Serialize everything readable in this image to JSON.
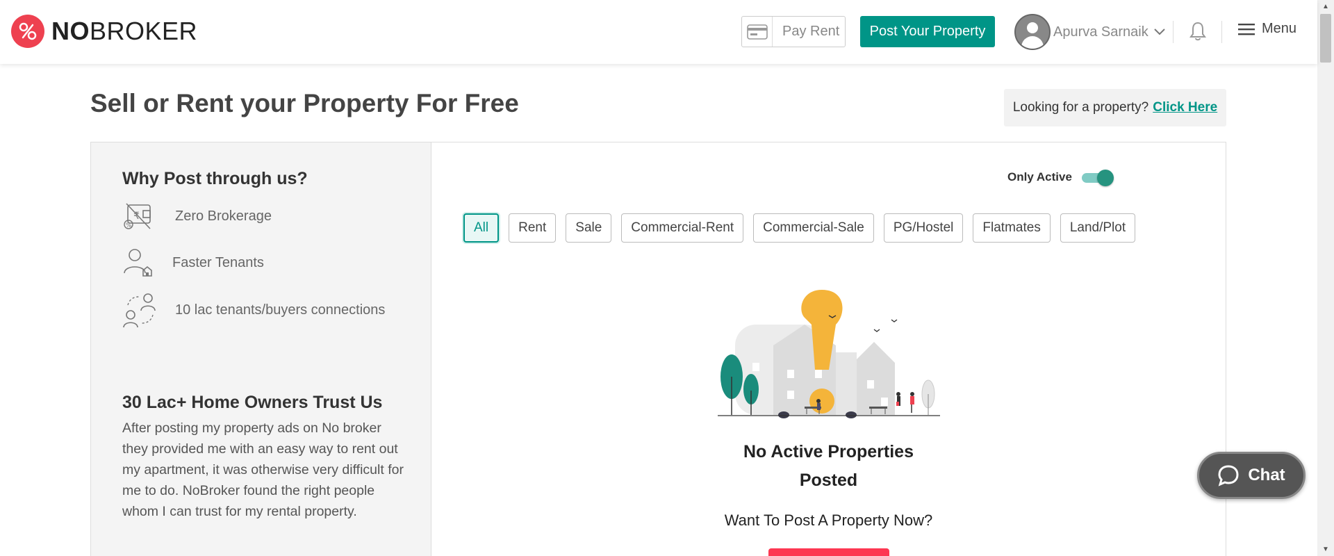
{
  "header": {
    "logo": {
      "brand_bold": "NO",
      "brand_light": "BROKER"
    },
    "pay_rent_label": "Pay Rent",
    "post_property_label": "Post Your Property",
    "user_name": "Apurva Sarnaik",
    "menu_label": "Menu",
    "icons": [
      "credit-card-icon",
      "user-avatar-icon",
      "chevron-down-icon",
      "bell-icon",
      "hamburger-menu-icon"
    ]
  },
  "page": {
    "title": "Sell or Rent your Property For Free",
    "looking_text": "Looking for a property?",
    "looking_link": "Click Here"
  },
  "sidebar": {
    "why_title": "Why Post through us?",
    "benefits": [
      {
        "label": "Zero Brokerage",
        "icon": "zero-brokerage-icon"
      },
      {
        "label": "Faster Tenants",
        "icon": "tenant-icon"
      },
      {
        "label": "10 lac tenants/buyers connections",
        "icon": "connections-icon"
      }
    ],
    "trust_title": "30 Lac+ Home Owners Trust Us",
    "testimonial": "After posting my property ads on No broker they provided me with an easy way to rent out my apartment, it was otherwise very difficult for me to do. NoBroker found the right people whom I can trust for my rental property."
  },
  "listings": {
    "only_active_label": "Only Active",
    "only_active_on": true,
    "filters": [
      "All",
      "Rent",
      "Sale",
      "Commercial-Rent",
      "Commercial-Sale",
      "PG/Hostel",
      "Flatmates",
      "Land/Plot"
    ],
    "selected_filter": "All",
    "empty_title_line1": "No Active Properties",
    "empty_title_line2": "Posted",
    "empty_subtitle": "Want To Post A Property Now?"
  },
  "chat": {
    "label": "Chat"
  },
  "colors": {
    "brand_red": "#ee4150",
    "teal": "#009587",
    "post_button_red": "#fd3752",
    "illustration_yellow": "#f4b43a"
  }
}
